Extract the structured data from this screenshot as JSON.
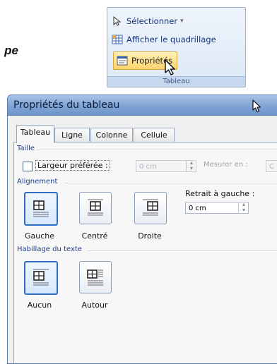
{
  "page": {
    "fragment_text": "pe"
  },
  "ribbon": {
    "items": [
      {
        "label": "Sélectionner",
        "icon": "cursor-select-icon",
        "has_dropdown": true
      },
      {
        "label": "Afficher le quadrillage",
        "icon": "grid-icon"
      },
      {
        "label": "Propriétés",
        "icon": "properties-icon",
        "highlighted": true
      }
    ],
    "group_label": "Tableau",
    "dropdown_glyph": "▾"
  },
  "dialog": {
    "title": "Propriétés du tableau",
    "tabs": [
      {
        "label": "Tableau",
        "active": true
      },
      {
        "label": "Ligne"
      },
      {
        "label": "Colonne"
      },
      {
        "label": "Cellule"
      }
    ],
    "taille": {
      "section_label": "Taille",
      "preferred_width_label": "Largeur préférée :",
      "preferred_width_checked": false,
      "preferred_width_value": "0 cm",
      "measure_in_label": "Mesurer en :",
      "measure_in_value": "C"
    },
    "alignement": {
      "section_label": "Alignement",
      "options": [
        {
          "label": "Gauche",
          "selected": true
        },
        {
          "label": "Centré"
        },
        {
          "label": "Droite"
        }
      ],
      "retrait_label": "Retrait à gauche :",
      "retrait_value": "0 cm"
    },
    "habillage": {
      "section_label": "Habillage du texte",
      "options": [
        {
          "label": "Aucun",
          "selected": true
        },
        {
          "label": "Autour"
        }
      ]
    }
  },
  "colors": {
    "accent": "#2f6ec4",
    "title_bar": "#7fa3d3",
    "ribbon_highlight": "#ffd36e"
  }
}
